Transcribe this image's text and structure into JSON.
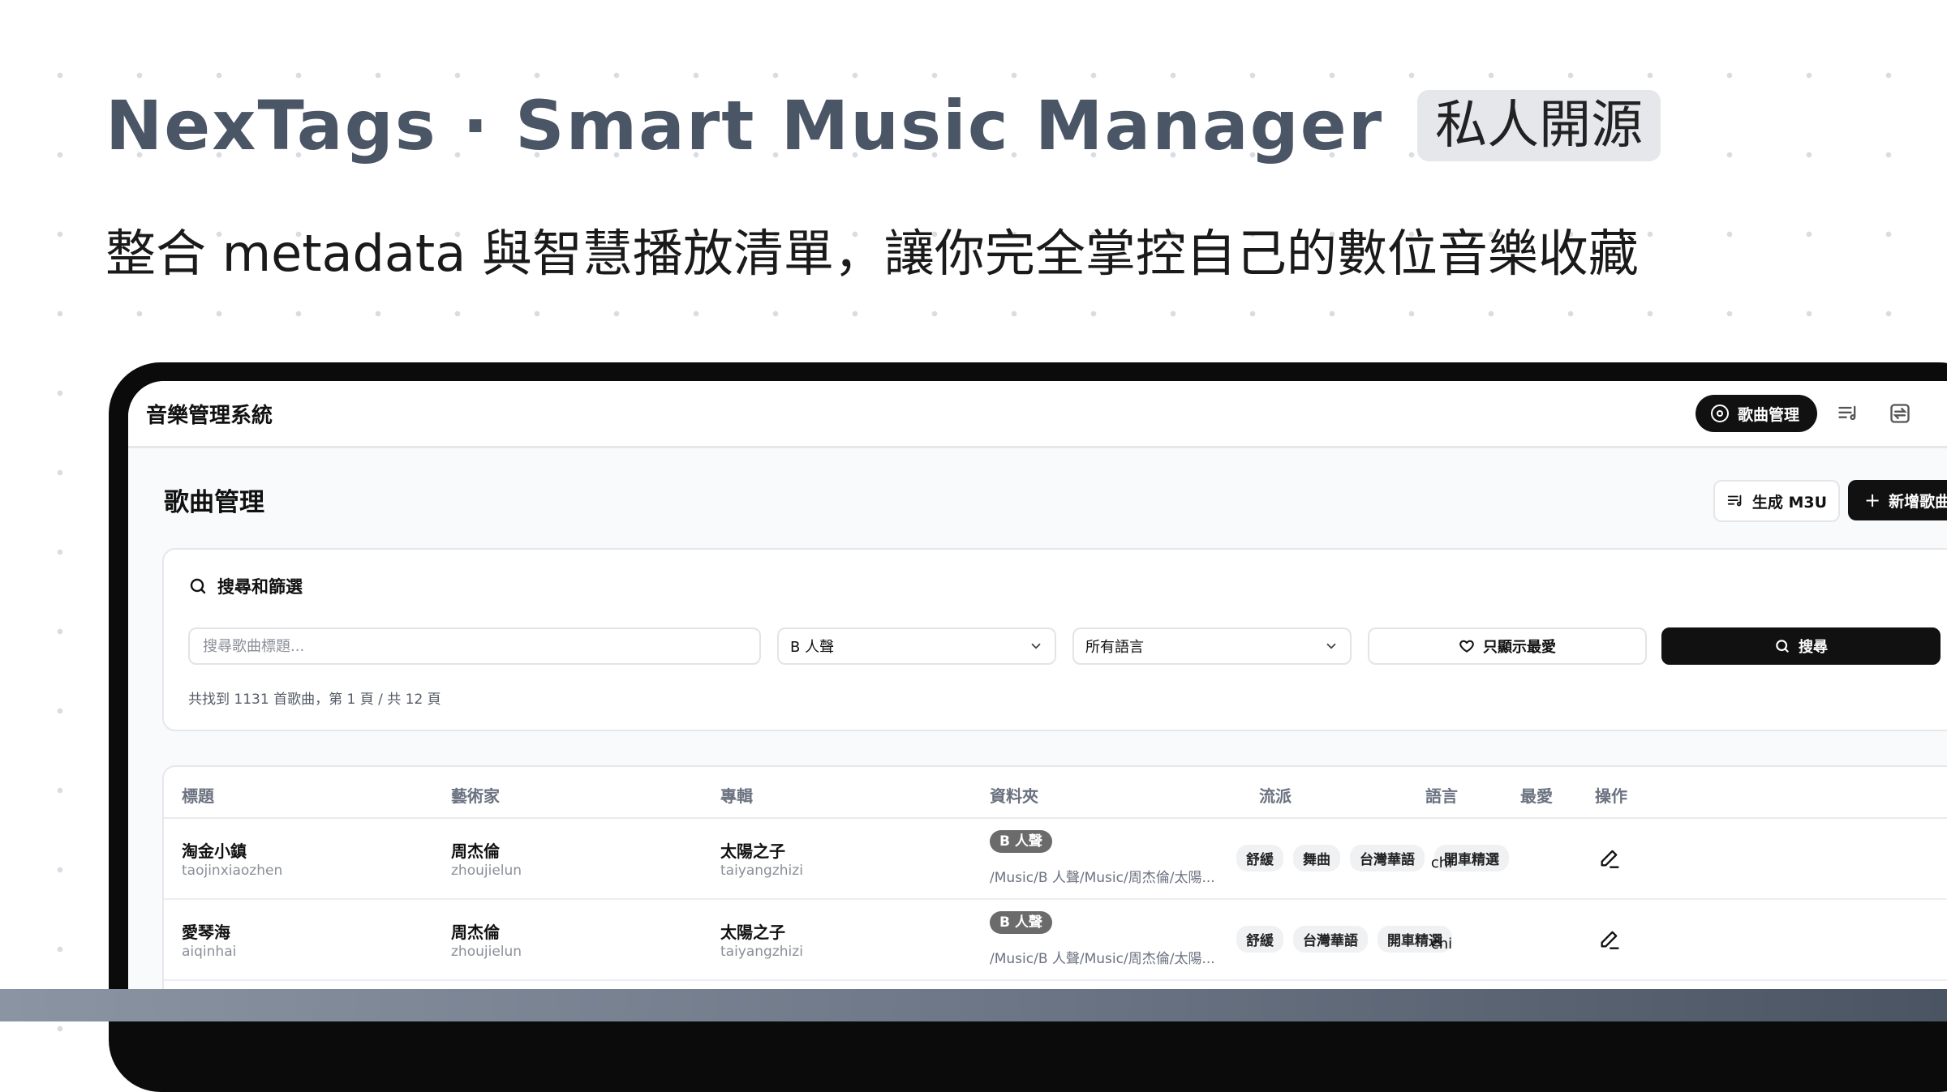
{
  "hero": {
    "title": "NexTags · Smart Music Manager",
    "badge": "私人開源",
    "subtitle": "整合 metadata 與智慧播放清單，讓你完全掌控自己的數位音樂收藏"
  },
  "app": {
    "title": "音樂管理系統",
    "nav": {
      "active_label": "歌曲管理",
      "icons": [
        "playlist-icon",
        "convert-icon"
      ]
    }
  },
  "page": {
    "title": "歌曲管理",
    "generate_m3u_label": "生成 M3U",
    "add_song_label": "新增歌曲"
  },
  "filters": {
    "heading": "搜尋和篩選",
    "search_placeholder": "搜尋歌曲標題...",
    "folder_value": "B 人聲",
    "language_value": "所有語言",
    "favorites_label": "只顯示最愛",
    "search_button": "搜尋",
    "result_summary": "共找到 1131 首歌曲，第 1 頁 / 共 12 頁"
  },
  "table": {
    "headers": [
      "標題",
      "藝術家",
      "專輯",
      "資料夾",
      "流派",
      "語言",
      "最愛",
      "操作"
    ],
    "rows": [
      {
        "title": "淘金小鎮",
        "title_sub": "taojinxiaozhen",
        "artist": "周杰倫",
        "artist_sub": "zhoujielun",
        "album": "太陽之子",
        "album_sub": "taiyangzhizi",
        "folder_badge": "B 人聲",
        "folder_path": "/Music/B 人聲/Music/周杰倫/太陽...",
        "genres": [
          "舒緩",
          "舞曲",
          "台灣華語",
          "開車精選"
        ],
        "language": "chi"
      },
      {
        "title": "愛琴海",
        "title_sub": "aiqinhai",
        "artist": "周杰倫",
        "artist_sub": "zhoujielun",
        "album": "太陽之子",
        "album_sub": "taiyangzhizi",
        "folder_badge": "B 人聲",
        "folder_path": "/Music/B 人聲/Music/周杰倫/太陽...",
        "genres": [
          "舒緩",
          "台灣華語",
          "開車精選"
        ],
        "language": "chi"
      }
    ]
  },
  "colors": {
    "hero_title": "#4a5566",
    "accent_dark": "#111111",
    "folder_badge": "#6b6b6b",
    "genre_tag_bg": "#f0f1f3"
  }
}
